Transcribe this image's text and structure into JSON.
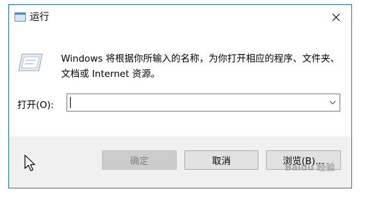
{
  "window": {
    "title": "运行",
    "description": "Windows 将根据你所输入的名称，为你打开相应的程序、文件夹、文档或 Internet 资源。",
    "open_label": "打开(O):",
    "input_value": ""
  },
  "buttons": {
    "ok": "确定",
    "cancel": "取消",
    "browse": "浏览(B)..."
  },
  "watermark": "Baidu 经验",
  "colors": {
    "border": "#1979ca",
    "window_bg": "#f0f0f0",
    "pane_bg": "#ffffff"
  },
  "icons": {
    "title": "run-icon",
    "close": "close-icon",
    "dropdown": "chevron-down-icon",
    "cursor": "mouse-pointer-icon"
  }
}
